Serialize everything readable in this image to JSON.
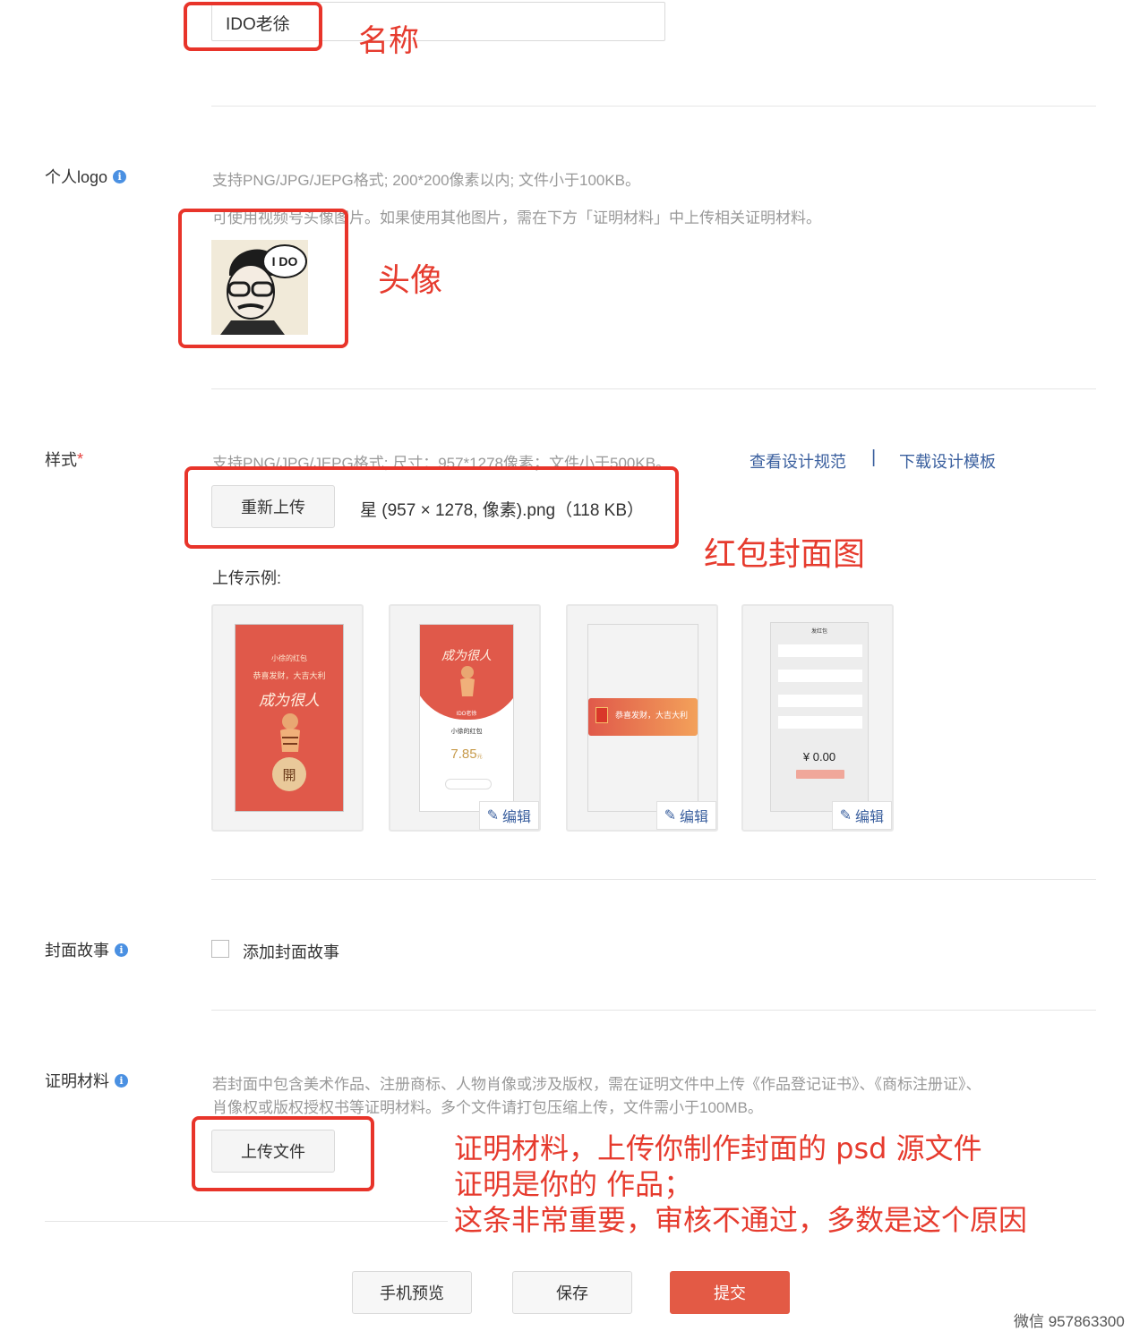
{
  "name_section": {
    "input_value": "IDO老徐",
    "annotation": "名称"
  },
  "logo_section": {
    "label": "个人logo",
    "hint1": "支持PNG/JPG/JEPG格式; 200*200像素以内; 文件小于100KB。",
    "hint2": "可使用视频号头像图片。如果使用其他图片，需在下方「证明材料」中上传相关证明材料。",
    "avatar_text": "I DO",
    "annotation": "头像"
  },
  "style_section": {
    "label": "样式",
    "required_mark": "*",
    "hint": "支持PNG/JPG/JEPG格式; 尺寸：957*1278像素；文件小于500KB。",
    "link_spec": "查看设计规范",
    "link_sep": "|",
    "link_template": "下载设计模板",
    "reupload_label": "重新上传",
    "file_name": "星 (957 × 1278, 像素).png（118 KB）",
    "annotation": "红包封面图",
    "example_label": "上传示例:",
    "edit_label": "编辑",
    "example1": {
      "title": "小徐的红包",
      "wish": "恭喜发财，大吉大利",
      "calligraphy": "成为很人",
      "open_char": "開"
    },
    "example2": {
      "calligraphy": "成为很人",
      "name": "IDO老徐",
      "sender": "小徐的红包",
      "amount": "7.85",
      "unit": "元"
    },
    "example3": {
      "wish": "恭喜发财，大吉大利"
    },
    "example4": {
      "header": "发红包",
      "amount": "¥ 0.00"
    }
  },
  "story_section": {
    "label": "封面故事",
    "checkbox_label": "添加封面故事"
  },
  "proof_section": {
    "label": "证明材料",
    "hint_line1": "若封面中包含美术作品、注册商标、人物肖像或涉及版权，需在证明文件中上传《作品登记证书》、《商标注册证》、",
    "hint_line2": "肖像权或版权授权书等证明材料。多个文件请打包压缩上传，文件需小于100MB。",
    "upload_label": "上传文件",
    "annotation_line1": "证明材料，上传你制作封面的 psd 源文件",
    "annotation_line2": "证明是你的 作品；",
    "annotation_line3": "这条非常重要，审核不通过，多数是这个原因"
  },
  "footer": {
    "preview_label": "手机预览",
    "save_label": "保存",
    "submit_label": "提交",
    "watermark": "微信 957863300"
  },
  "colors": {
    "annotation_red": "#e63b2e",
    "primary_red": "#e35a45",
    "link_blue": "#3a5f9e",
    "info_blue": "#4a90e2"
  }
}
